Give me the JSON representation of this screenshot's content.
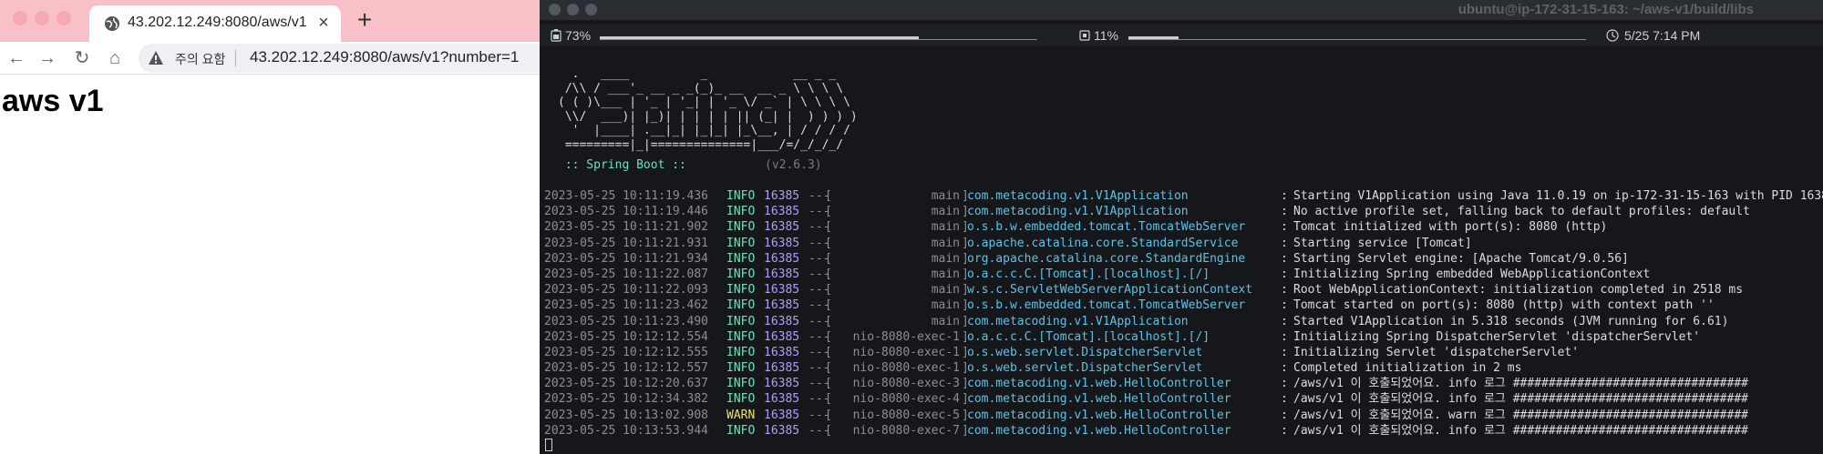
{
  "browser": {
    "tab": {
      "title": "43.202.12.249:8080/aws/v1?n",
      "close": "×"
    },
    "new_tab": "+",
    "nav": {
      "back": "←",
      "forward": "→",
      "reload": "↻",
      "home": "⌂"
    },
    "address": {
      "security": "주의 요함",
      "url": "43.202.12.249:8080/aws/v1?number=1"
    },
    "page": {
      "heading": "aws v1"
    }
  },
  "terminal": {
    "title": "ubuntu@ip-172-31-15-163: ~/aws-v1/build/libs",
    "status": {
      "battery": "73%",
      "cpu": "11%",
      "datetime": "5/25 7:14 PM",
      "battery_level": 0.73,
      "cpu_level": 0.11
    },
    "banner": "  .   ____          _            __ _ _\n /\\\\ / ___'_ __ _ _(_)_ __  __ _ \\ \\ \\ \\\n( ( )\\___ | '_ | '_| | '_ \\/ _` | \\ \\ \\ \\\n \\\\/  ___)| |_)| | | | | || (_| |  ) ) ) )\n  '  |____| .__|_| |_|_| |_\\__, | / / / /\n =========|_|==============|___/=/_/_/_/",
    "boot_label": " :: Spring Boot :: ",
    "boot_version": "(v2.6.3)",
    "cursor": "▯",
    "logs": [
      {
        "ts": "2023-05-25 10:11:19.436",
        "level": "INFO",
        "pid": "16385",
        "dash": "---",
        "thread": "main",
        "logger": "com.metacoding.v1.V1Application",
        "msg": "Starting V1Application using Java 11.0.19 on ip-172-31-15-163 with PID 1638"
      },
      {
        "ts": "2023-05-25 10:11:19.446",
        "level": "INFO",
        "pid": "16385",
        "dash": "---",
        "thread": "main",
        "logger": "com.metacoding.v1.V1Application",
        "msg": "No active profile set, falling back to default profiles: default"
      },
      {
        "ts": "2023-05-25 10:11:21.902",
        "level": "INFO",
        "pid": "16385",
        "dash": "---",
        "thread": "main",
        "logger": "o.s.b.w.embedded.tomcat.TomcatWebServer",
        "msg": "Tomcat initialized with port(s): 8080 (http)"
      },
      {
        "ts": "2023-05-25 10:11:21.931",
        "level": "INFO",
        "pid": "16385",
        "dash": "---",
        "thread": "main",
        "logger": "o.apache.catalina.core.StandardService",
        "msg": "Starting service [Tomcat]"
      },
      {
        "ts": "2023-05-25 10:11:21.934",
        "level": "INFO",
        "pid": "16385",
        "dash": "---",
        "thread": "main",
        "logger": "org.apache.catalina.core.StandardEngine",
        "msg": "Starting Servlet engine: [Apache Tomcat/9.0.56]"
      },
      {
        "ts": "2023-05-25 10:11:22.087",
        "level": "INFO",
        "pid": "16385",
        "dash": "---",
        "thread": "main",
        "logger": "o.a.c.c.C.[Tomcat].[localhost].[/]",
        "msg": "Initializing Spring embedded WebApplicationContext"
      },
      {
        "ts": "2023-05-25 10:11:22.093",
        "level": "INFO",
        "pid": "16385",
        "dash": "---",
        "thread": "main",
        "logger": "w.s.c.ServletWebServerApplicationContext",
        "msg": "Root WebApplicationContext: initialization completed in 2518 ms"
      },
      {
        "ts": "2023-05-25 10:11:23.462",
        "level": "INFO",
        "pid": "16385",
        "dash": "---",
        "thread": "main",
        "logger": "o.s.b.w.embedded.tomcat.TomcatWebServer",
        "msg": "Tomcat started on port(s): 8080 (http) with context path ''"
      },
      {
        "ts": "2023-05-25 10:11:23.490",
        "level": "INFO",
        "pid": "16385",
        "dash": "---",
        "thread": "main",
        "logger": "com.metacoding.v1.V1Application",
        "msg": "Started V1Application in 5.318 seconds (JVM running for 6.61)"
      },
      {
        "ts": "2023-05-25 10:12:12.554",
        "level": "INFO",
        "pid": "16385",
        "dash": "---",
        "thread": "nio-8080-exec-1",
        "logger": "o.a.c.c.C.[Tomcat].[localhost].[/]",
        "msg": "Initializing Spring DispatcherServlet 'dispatcherServlet'"
      },
      {
        "ts": "2023-05-25 10:12:12.555",
        "level": "INFO",
        "pid": "16385",
        "dash": "---",
        "thread": "nio-8080-exec-1",
        "logger": "o.s.web.servlet.DispatcherServlet",
        "msg": "Initializing Servlet 'dispatcherServlet'"
      },
      {
        "ts": "2023-05-25 10:12:12.557",
        "level": "INFO",
        "pid": "16385",
        "dash": "---",
        "thread": "nio-8080-exec-1",
        "logger": "o.s.web.servlet.DispatcherServlet",
        "msg": "Completed initialization in 2 ms"
      },
      {
        "ts": "2023-05-25 10:12:20.637",
        "level": "INFO",
        "pid": "16385",
        "dash": "---",
        "thread": "nio-8080-exec-3",
        "logger": "com.metacoding.v1.web.HelloController",
        "msg": "/aws/v1 이 호출되었어요. info 로그 #################################"
      },
      {
        "ts": "2023-05-25 10:12:34.382",
        "level": "INFO",
        "pid": "16385",
        "dash": "---",
        "thread": "nio-8080-exec-4",
        "logger": "com.metacoding.v1.web.HelloController",
        "msg": "/aws/v1 이 호출되었어요. info 로그 #################################"
      },
      {
        "ts": "2023-05-25 10:13:02.908",
        "level": "WARN",
        "pid": "16385",
        "dash": "---",
        "thread": "nio-8080-exec-5",
        "logger": "com.metacoding.v1.web.HelloController",
        "msg": "/aws/v1 이 호출되었어요. warn 로그 #################################"
      },
      {
        "ts": "2023-05-25 10:13:53.944",
        "level": "INFO",
        "pid": "16385",
        "dash": "---",
        "thread": "nio-8080-exec-7",
        "logger": "com.metacoding.v1.web.HelloController",
        "msg": "/aws/v1 이 호출되었어요. info 로그 #################################"
      }
    ]
  }
}
